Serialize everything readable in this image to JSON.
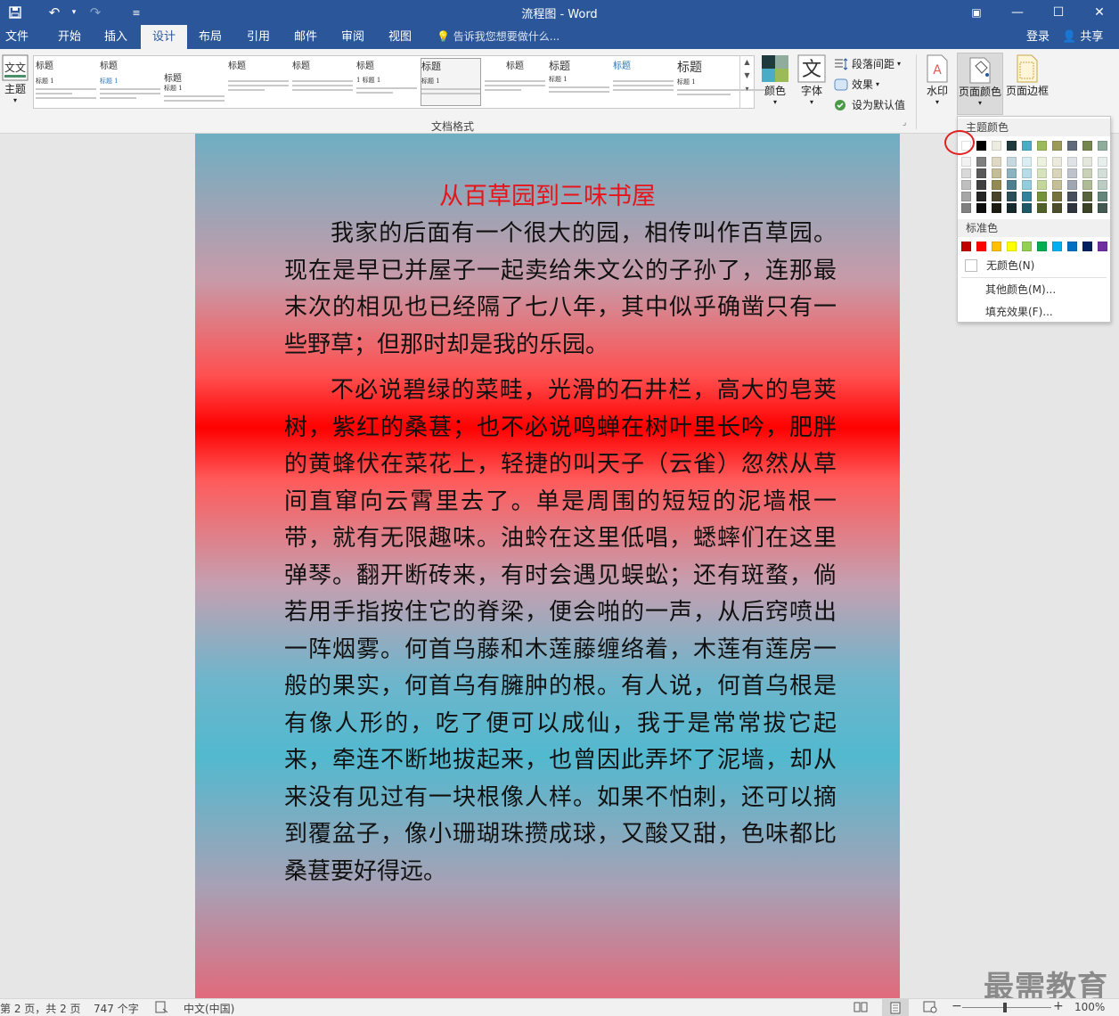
{
  "titlebar": {
    "title": "流程图 - Word",
    "save_icon": "save-icon",
    "undo_icon": "undo-icon",
    "redo_icon": "redo-icon",
    "customize_icon": "customize-icon",
    "ribbon_display_icon": "ribbon-display-icon",
    "minimize_icon": "minimize-icon",
    "maximize_icon": "maximize-icon",
    "close_icon": "close-icon"
  },
  "tabs": {
    "items": [
      "文件",
      "开始",
      "插入",
      "设计",
      "布局",
      "引用",
      "邮件",
      "审阅",
      "视图"
    ],
    "active": "设计",
    "tellme": "告诉我您想要做什么...",
    "login": "登录",
    "share": "共享"
  },
  "ribbon": {
    "theme_label": "主题",
    "styles": [
      {
        "heading": "标题",
        "sub": "标题 1"
      },
      {
        "heading": "标题",
        "sub": "标题 1"
      },
      {
        "heading": "标题",
        "sub": "标题 1"
      },
      {
        "heading": "标题",
        "sub": ""
      },
      {
        "heading": "标题",
        "sub": ""
      },
      {
        "heading": "标题",
        "sub": "1 标题 1"
      },
      {
        "heading": "标题",
        "sub": "标题 1"
      },
      {
        "heading": "标题",
        "sub": ""
      },
      {
        "heading": "标题",
        "sub": "标题 1"
      },
      {
        "heading": "标题",
        "sub": ""
      },
      {
        "heading": "标题",
        "sub": "标题 1"
      }
    ],
    "colors_label": "颜色",
    "fonts_label": "字体",
    "paragraph_spacing": "段落间距",
    "effects": "效果",
    "set_default": "设为默认值",
    "group_document_format": "文档格式",
    "watermark_label": "水印",
    "page_color_label": "页面颜色",
    "page_border_label": "页面边框"
  },
  "document": {
    "title": "从百草园到三味书屋",
    "paragraphs": [
      "我家的后面有一个很大的园，相传叫作百草园。现在是早已并屋子一起卖给朱文公的子孙了，连那最末次的相见也已经隔了七八年，其中似乎确凿只有一些野草；但那时却是我的乐园。",
      "不必说碧绿的菜畦，光滑的石井栏，高大的皂荚树，紫红的桑葚；也不必说鸣蝉在树叶里长吟，肥胖的黄蜂伏在菜花上，轻捷的叫天子（云雀）忽然从草间直窜向云霄里去了。单是周围的短短的泥墙根一带，就有无限趣味。油蛉在这里低唱，蟋蟀们在这里弹琴。翻开断砖来，有时会遇见蜈蚣；还有斑蝥，倘若用手指按住它的脊梁，便会啪的一声，从后窍喷出一阵烟雾。何首乌藤和木莲藤缠络着，木莲有莲房一般的果实，何首乌有臃肿的根。有人说，何首乌根是有像人形的，吃了便可以成仙，我于是常常拔它起来，牵连不断地拔起来，也曾因此弄坏了泥墙，却从来没有见过有一块根像人样。如果不怕刺，还可以摘到覆盆子，像小珊瑚珠攒成球，又酸又甜，色味都比桑葚要好得远。"
    ]
  },
  "dropdown": {
    "theme_colors_label": "主题颜色",
    "theme_colors_top": [
      "#ffffff",
      "#000000",
      "#eeece1",
      "#1f3a3d",
      "#4bacc6",
      "#9bbb59",
      "#9d9a58",
      "#5f6b7a",
      "#76864f",
      "#8fac9c"
    ],
    "theme_colors_shades": [
      [
        "#f2f2f2",
        "#d9d9d9",
        "#bfbfbf",
        "#a6a6a6",
        "#808080"
      ],
      [
        "#7f7f7f",
        "#595959",
        "#404040",
        "#262626",
        "#0d0d0d"
      ],
      [
        "#ddd9c3",
        "#c4bd97",
        "#948a54",
        "#4a452a",
        "#1d1b10"
      ],
      [
        "#c6d9df",
        "#8db3c0",
        "#4f7f8f",
        "#2b4f58",
        "#16292d"
      ],
      [
        "#dbeef3",
        "#b7dde8",
        "#92cddc",
        "#31849b",
        "#205867"
      ],
      [
        "#ebf1dd",
        "#d7e3bc",
        "#c3d69b",
        "#76923c",
        "#4f6128"
      ],
      [
        "#ebeadc",
        "#d8d5b9",
        "#c4bf96",
        "#76733e",
        "#4e4d29"
      ],
      [
        "#dfe2e6",
        "#bfc4cc",
        "#9fa7b2",
        "#47505c",
        "#2f353d"
      ],
      [
        "#e4e8dc",
        "#c9d2b9",
        "#aebb96",
        "#58643b",
        "#3b4327"
      ],
      [
        "#e8eeeb",
        "#d2ded7",
        "#bbcdc3",
        "#65867a",
        "#435951"
      ]
    ],
    "standard_colors_label": "标准色",
    "standard_colors": [
      "#c00000",
      "#ff0000",
      "#ffc000",
      "#ffff00",
      "#92d050",
      "#00b050",
      "#00b0f0",
      "#0070c0",
      "#002060",
      "#7030a0"
    ],
    "no_color": "无颜色(N)",
    "more_colors": "其他颜色(M)...",
    "fill_effects": "填充效果(F)..."
  },
  "statusbar": {
    "page": "第 2 页，共 2 页",
    "words": "747 个字",
    "proofing_icon": "proofing-icon",
    "language": "中文(中国)",
    "zoom": "100%"
  },
  "watermark": "最需教育",
  "colors": {
    "accent": "#2b579a",
    "title_red": "#e8141b"
  }
}
